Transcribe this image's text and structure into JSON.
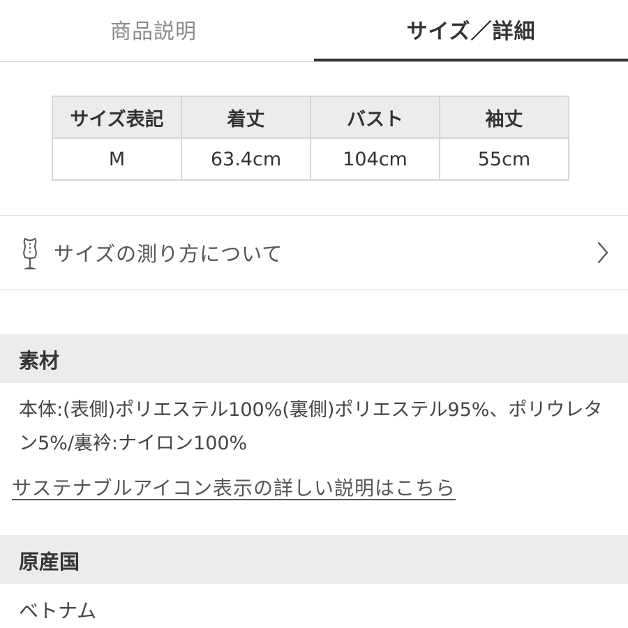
{
  "tabs": {
    "description": "商品説明",
    "size_detail": "サイズ／詳細"
  },
  "size_table": {
    "headers": [
      "サイズ表記",
      "着丈",
      "バスト",
      "袖丈"
    ],
    "rows": [
      [
        "M",
        "63.4cm",
        "104cm",
        "55cm"
      ]
    ]
  },
  "measure": {
    "label": "サイズの測り方について",
    "icon": "mannequin-icon",
    "chevron": "chevron-right-icon"
  },
  "material": {
    "title": "素材",
    "text": "本体:(表側)ポリエステル100%(裏側)ポリエステル95%、ポリウレタン5%/裏衿:ナイロン100%",
    "sustain_link": "サステナブルアイコン表示の詳しい説明はこちら"
  },
  "origin": {
    "title": "原産国",
    "text": "ベトナム"
  },
  "colors": {
    "active_text": "#333333",
    "inactive_text": "#8a8a8a",
    "header_bg": "#ececec",
    "border": "#d6d6d6"
  }
}
